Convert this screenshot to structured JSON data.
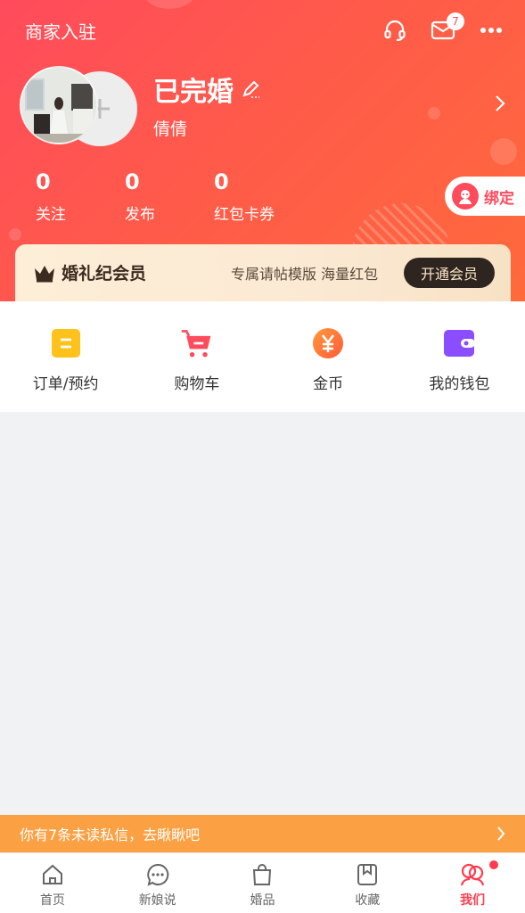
{
  "header": {
    "merchant_entry": "商家入驻",
    "message_badge": "7",
    "nickname": "已完婚",
    "username": "倩倩",
    "stats": [
      {
        "value": "0",
        "label": "关注"
      },
      {
        "value": "0",
        "label": "发布"
      },
      {
        "value": "0",
        "label": "红包卡券"
      }
    ],
    "bind_label": "绑定"
  },
  "vip": {
    "title": "婚礼纪会员",
    "description": "专属请帖模版 海量红包",
    "button": "开通会员"
  },
  "quick_actions": [
    {
      "label": "订单/预约",
      "icon": "order-icon"
    },
    {
      "label": "购物车",
      "icon": "cart-icon"
    },
    {
      "label": "金币",
      "icon": "coin-icon"
    },
    {
      "label": "我的钱包",
      "icon": "wallet-icon"
    }
  ],
  "notification": {
    "text": "你有7条未读私信，去瞅瞅吧"
  },
  "tabbar": [
    {
      "label": "首页",
      "icon": "home-icon",
      "active": false
    },
    {
      "label": "新娘说",
      "icon": "chat-icon",
      "active": false
    },
    {
      "label": "婚品",
      "icon": "bag-icon",
      "active": false
    },
    {
      "label": "收藏",
      "icon": "bookmark-icon",
      "active": false
    },
    {
      "label": "我们",
      "icon": "couple-icon",
      "active": true
    }
  ],
  "colors": {
    "brand": "#ff4b5c",
    "notify": "#fba144",
    "vip_button": "#2f2520"
  }
}
